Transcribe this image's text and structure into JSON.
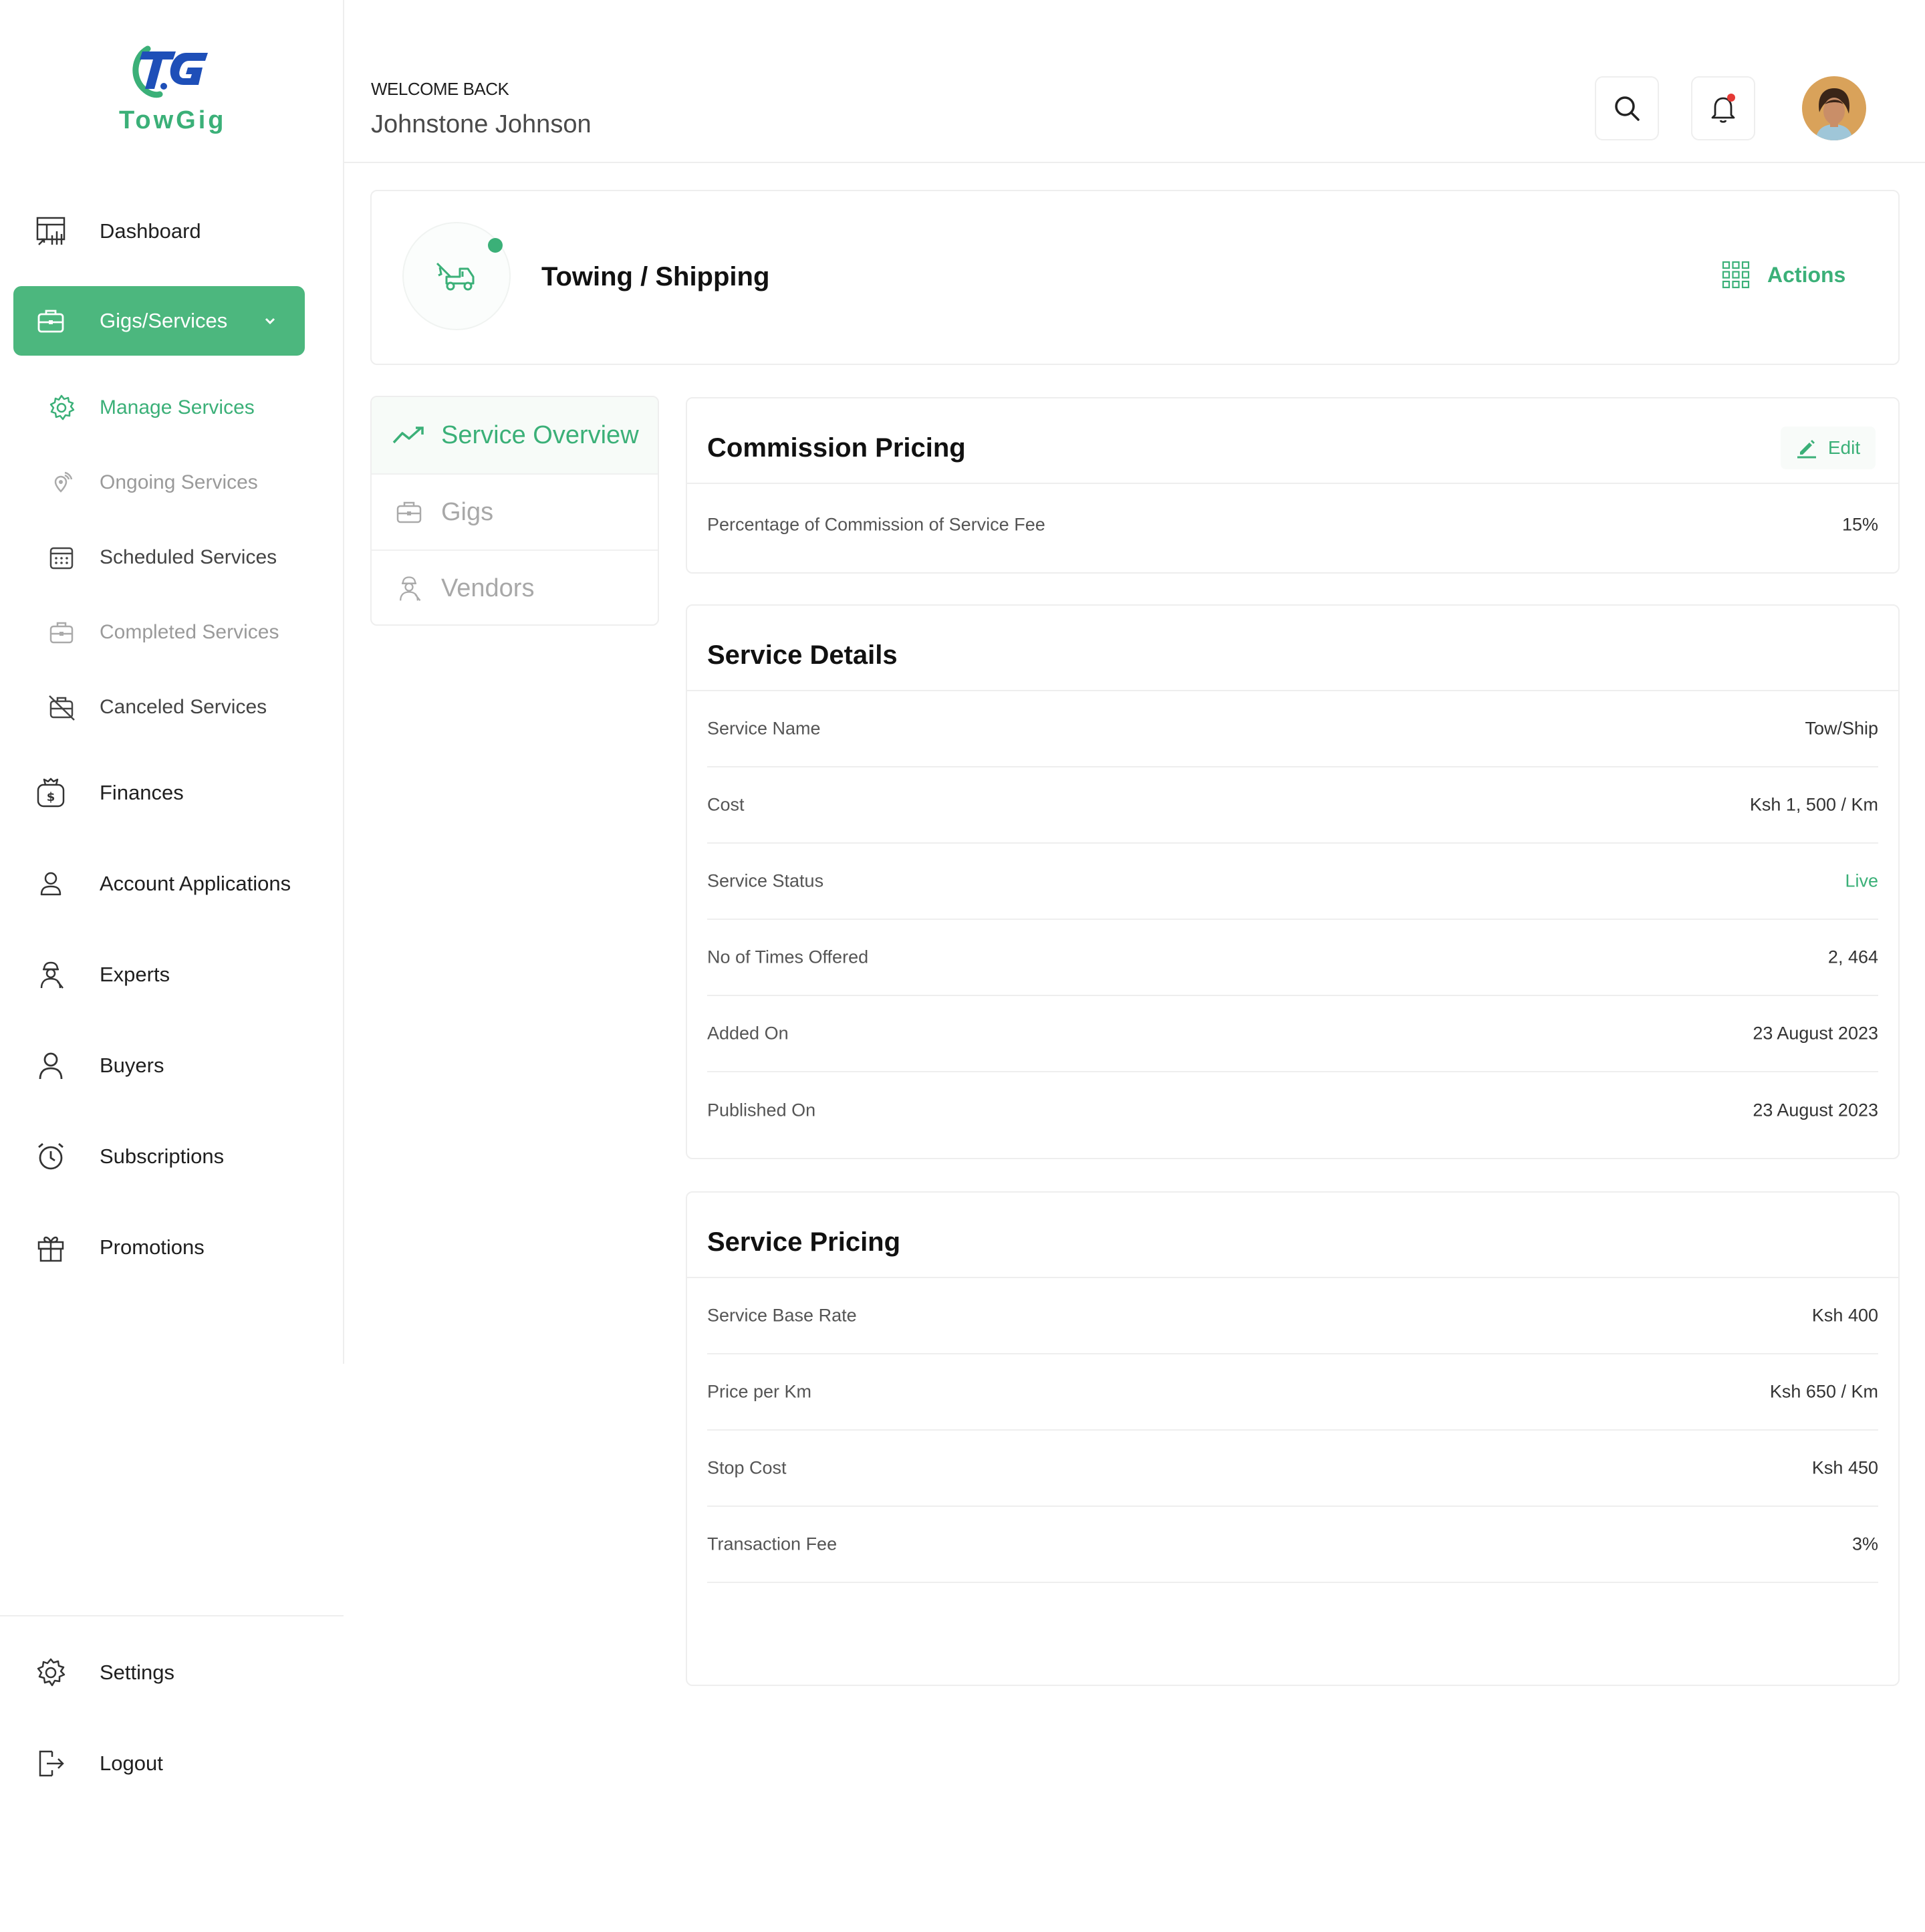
{
  "app": {
    "brand": "TowGig",
    "logo_mark": "TG"
  },
  "colors": {
    "accent": "#4cb77e",
    "accent_text": "#3bb078",
    "notification_dot": "#e53935"
  },
  "sidebar": {
    "main_items": [
      {
        "label": "Dashboard",
        "icon": "dashboard-chart-icon"
      },
      {
        "label": "Gigs/Services",
        "icon": "briefcase-icon",
        "active": true
      }
    ],
    "sub_items": [
      {
        "label": "Manage Services",
        "icon": "gear-icon"
      },
      {
        "label": "Ongoing Services",
        "icon": "location-signal-icon"
      },
      {
        "label": "Scheduled Services",
        "icon": "calendar-icon"
      },
      {
        "label": "Completed Services",
        "icon": "briefcase-icon"
      },
      {
        "label": "Canceled Services",
        "icon": "briefcase-off-icon"
      }
    ],
    "more_items": [
      {
        "label": "Finances",
        "icon": "money-bag-icon"
      },
      {
        "label": "Account Applications",
        "icon": "user-icon"
      },
      {
        "label": "Experts",
        "icon": "worker-icon"
      },
      {
        "label": "Buyers",
        "icon": "person-icon"
      },
      {
        "label": "Subscriptions",
        "icon": "alarm-clock-icon"
      },
      {
        "label": "Promotions",
        "icon": "gift-icon"
      }
    ],
    "bottom_items": [
      {
        "label": "Settings",
        "icon": "gear-icon"
      },
      {
        "label": "Logout",
        "icon": "logout-icon"
      }
    ]
  },
  "header": {
    "welcome": "WELCOME BACK",
    "user_name": "Johnstone Johnson",
    "search_icon": "search-icon",
    "notification_icon": "bell-icon"
  },
  "service": {
    "title": "Towing / Shipping",
    "icon": "tow-truck-icon",
    "actions_label": "Actions"
  },
  "tabs": [
    {
      "label": "Service Overview",
      "icon": "trend-line-icon"
    },
    {
      "label": "Gigs",
      "icon": "briefcase-icon"
    },
    {
      "label": "Vendors",
      "icon": "worker-icon"
    }
  ],
  "commission": {
    "title": "Commission Pricing",
    "edit_label": "Edit",
    "rows": [
      {
        "key": "Percentage of Commission of Service Fee",
        "value": "15%"
      }
    ]
  },
  "details": {
    "title": "Service Details",
    "rows": [
      {
        "key": "Service Name",
        "value": "Tow/Ship"
      },
      {
        "key": "Cost",
        "value": "Ksh 1, 500 / Km"
      },
      {
        "key": "Service Status",
        "value": "Live"
      },
      {
        "key": "No of Times Offered",
        "value": "2, 464"
      },
      {
        "key": "Added On",
        "value": "23 August 2023"
      },
      {
        "key": "Published On",
        "value": "23 August 2023"
      }
    ]
  },
  "pricing": {
    "title": "Service Pricing",
    "rows": [
      {
        "key": "Service Base Rate",
        "value": "Ksh 400"
      },
      {
        "key": "Price per Km",
        "value": "Ksh 650 / Km"
      },
      {
        "key": "Stop Cost",
        "value": "Ksh 450"
      },
      {
        "key": "Transaction Fee",
        "value": "3%"
      }
    ]
  }
}
